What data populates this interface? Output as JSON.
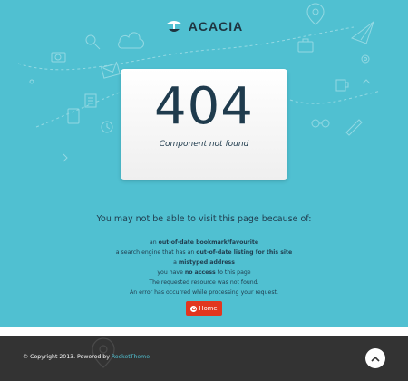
{
  "brand": {
    "name": "ACACIA"
  },
  "error": {
    "code": "404",
    "message": "Component not found"
  },
  "reasons": {
    "title": "You may not be able to visit this page because of:",
    "items": [
      {
        "pre": "an ",
        "bold": "out-of-date bookmark/favourite",
        "mid": "",
        "bold2": "",
        "post": ""
      },
      {
        "pre": "a search engine that has an ",
        "bold": "out-of-date listing for this site",
        "mid": "",
        "bold2": "",
        "post": ""
      },
      {
        "pre": "a ",
        "bold": "mistyped address",
        "mid": "",
        "bold2": "",
        "post": ""
      },
      {
        "pre": "you have ",
        "bold": "no access",
        "mid": " to this page",
        "bold2": "",
        "post": ""
      },
      {
        "pre": "The requested resource was not found.",
        "bold": "",
        "mid": "",
        "bold2": "",
        "post": ""
      },
      {
        "pre": "An error has occurred while processing your request.",
        "bold": "",
        "mid": "",
        "bold2": "",
        "post": ""
      }
    ]
  },
  "home_button": {
    "label": "Home",
    "icon": "home-circle-icon"
  },
  "footer": {
    "copyright": "© Copyright 2013. Powered by ",
    "powered_link": "RocketTheme",
    "top_icon": "chevron-up-icon"
  },
  "colors": {
    "hero": "#50c0d1",
    "text": "#1f3b4d",
    "button": "#e2361f",
    "footer": "#333333"
  }
}
